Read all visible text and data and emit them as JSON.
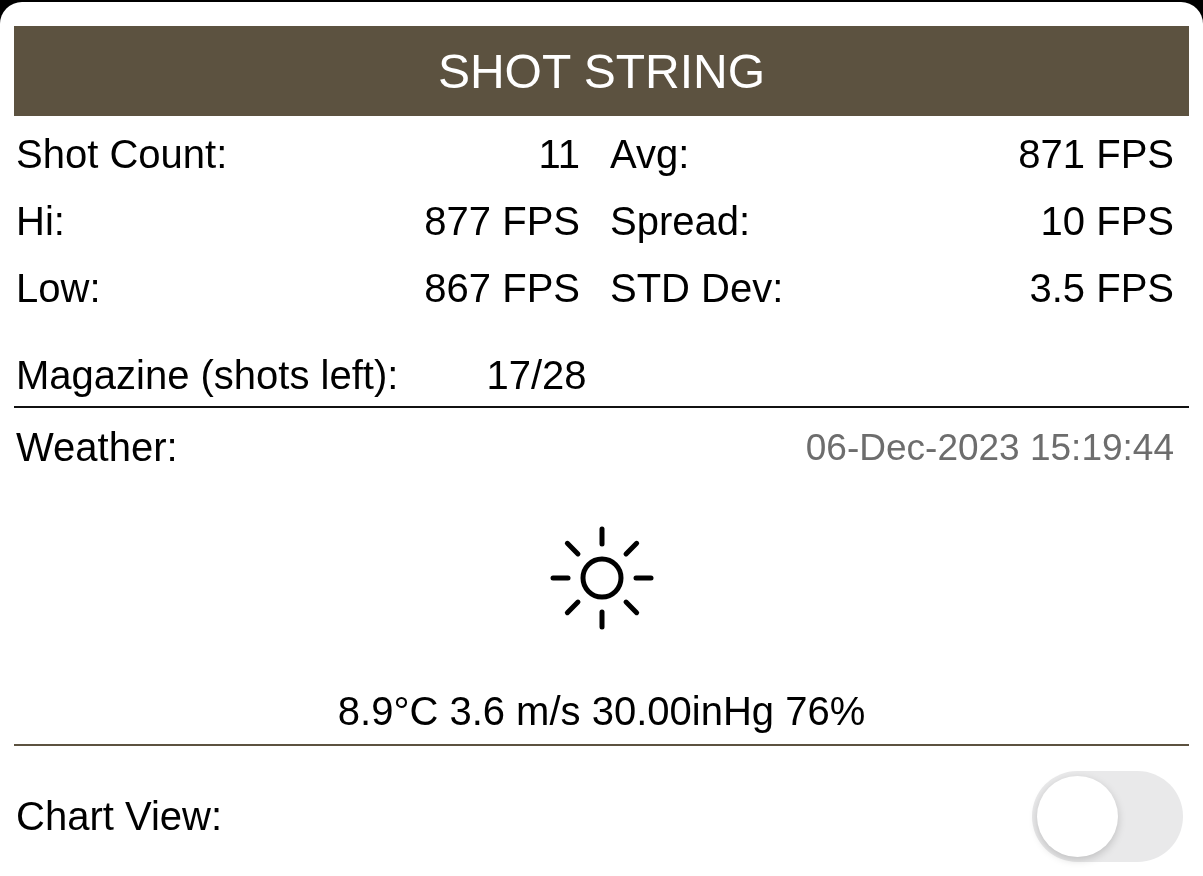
{
  "header": {
    "title": "SHOT STRING"
  },
  "stats": [
    {
      "label": "Shot Count:",
      "value": "11"
    },
    {
      "label": "Avg:",
      "value": "871 FPS"
    },
    {
      "label": "Hi:",
      "value": "877 FPS"
    },
    {
      "label": "Spread:",
      "value": "10 FPS"
    },
    {
      "label": "Low:",
      "value": "867 FPS"
    },
    {
      "label": "STD Dev:",
      "value": "3.5 FPS"
    }
  ],
  "magazine": {
    "label": "Magazine (shots left):",
    "value": "17/28"
  },
  "weather": {
    "label": "Weather:",
    "timestamp": "06-Dec-2023 15:19:44",
    "summary": "8.9°C 3.6 m/s 30.00inHg 76%"
  },
  "chart_view": {
    "label": "Chart View:",
    "on": false
  }
}
